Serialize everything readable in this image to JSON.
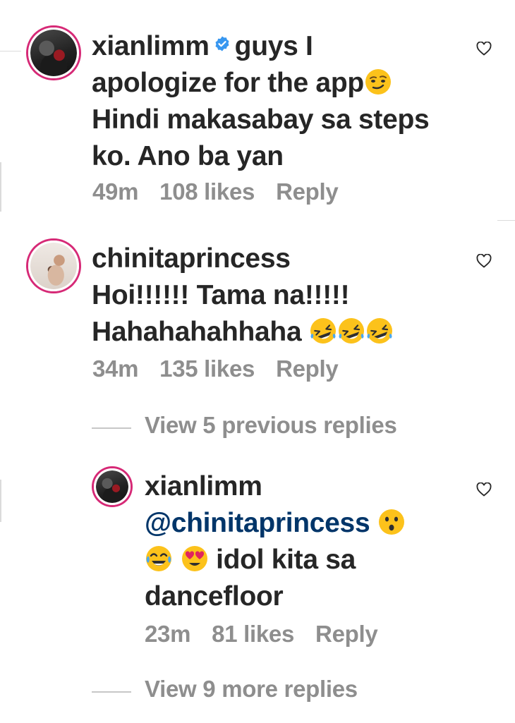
{
  "comments": [
    {
      "username": "xianlimm",
      "verified": true,
      "lines": [
        "guys I",
        "apologize for the app",
        "Hindi makasabay sa steps",
        "ko. Ano ba yan"
      ],
      "time": "49m",
      "likes": "108 likes",
      "reply_label": "Reply",
      "emoji": [
        "smirk-emoji"
      ]
    },
    {
      "username": "chinitaprincess",
      "verified": false,
      "lines": [
        "Hoi!!!!!! Tama na!!!!!",
        "Hahahahahhaha"
      ],
      "time": "34m",
      "likes": "135 likes",
      "reply_label": "Reply",
      "emoji": [
        "rolling-laughing-emoji",
        "rolling-laughing-emoji",
        "rolling-laughing-emoji"
      ]
    }
  ],
  "view_previous": "View 5 previous replies",
  "reply": {
    "username": "xianlimm",
    "mention": "@chinitaprincess",
    "lines": [
      "idol kita sa",
      "dancefloor"
    ],
    "time": "23m",
    "likes": "81 likes",
    "reply_label": "Reply",
    "emoji": [
      "hushed-emoji",
      "tears-of-joy-emoji",
      "heart-eyes-emoji"
    ]
  },
  "view_more": "View 9 more replies",
  "colors": {
    "text": "#262626",
    "meta": "#8e8e8e",
    "mention": "#003569",
    "verified": "#3897f0",
    "story_ring": "#d62976"
  }
}
